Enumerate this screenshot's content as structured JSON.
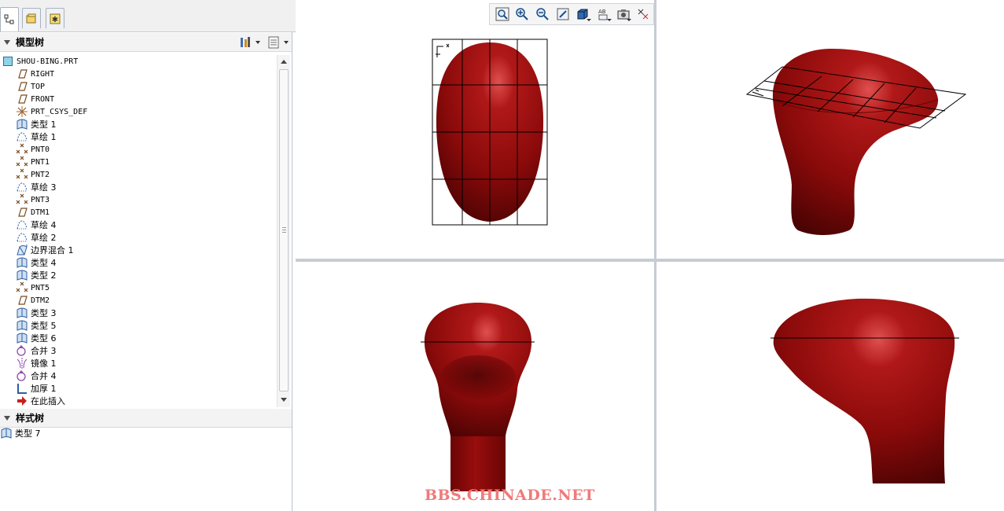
{
  "model_tree": {
    "header": "模型树",
    "root": "SHOU-BING.PRT",
    "items": [
      {
        "label": "RIGHT",
        "icon": "datum-plane-icon",
        "mono": true
      },
      {
        "label": "TOP",
        "icon": "datum-plane-icon",
        "mono": true
      },
      {
        "label": "FRONT",
        "icon": "datum-plane-icon",
        "mono": true
      },
      {
        "label": "PRT_CSYS_DEF",
        "icon": "coordinate-system-icon",
        "mono": true
      },
      {
        "label": "类型 1",
        "icon": "style-surface-icon"
      },
      {
        "label": "草绘 1",
        "icon": "sketch-icon"
      },
      {
        "label": "PNT0",
        "icon": "datum-point-icon",
        "mono": true
      },
      {
        "label": "PNT1",
        "icon": "datum-point-icon",
        "mono": true
      },
      {
        "label": "PNT2",
        "icon": "datum-point-icon",
        "mono": true
      },
      {
        "label": "草绘 3",
        "icon": "sketch-icon"
      },
      {
        "label": "PNT3",
        "icon": "datum-point-icon",
        "mono": true
      },
      {
        "label": "DTM1",
        "icon": "datum-plane-icon",
        "mono": true
      },
      {
        "label": "草绘 4",
        "icon": "sketch-icon"
      },
      {
        "label": "草绘 2",
        "icon": "sketch-icon"
      },
      {
        "label": "边界混合 1",
        "icon": "boundary-blend-icon"
      },
      {
        "label": "类型 4",
        "icon": "style-surface-icon"
      },
      {
        "label": "类型 2",
        "icon": "style-surface-icon"
      },
      {
        "label": "PNT5",
        "icon": "datum-point-icon",
        "mono": true
      },
      {
        "label": "DTM2",
        "icon": "datum-plane-icon",
        "mono": true
      },
      {
        "label": "类型 3",
        "icon": "style-surface-icon"
      },
      {
        "label": "类型 5",
        "icon": "style-surface-icon"
      },
      {
        "label": "类型 6",
        "icon": "style-surface-icon"
      },
      {
        "label": "合并 3",
        "icon": "merge-icon"
      },
      {
        "label": "镜像 1",
        "icon": "mirror-icon"
      },
      {
        "label": "合并 4",
        "icon": "merge-icon"
      },
      {
        "label": "加厚 1",
        "icon": "thicken-icon"
      },
      {
        "label": "在此插入",
        "icon": "insert-here-arrow-icon"
      }
    ]
  },
  "style_tree": {
    "header": "样式树",
    "items": [
      {
        "label": "类型 7",
        "icon": "style-surface-icon"
      }
    ]
  },
  "view_toolbar": {
    "buttons": [
      "refit-icon",
      "zoom-in-icon",
      "zoom-out-icon",
      "repaint-icon",
      "display-style-icon",
      "annotation-display-icon",
      "saved-orientations-icon",
      "datum-display-icon"
    ]
  },
  "watermark": "BBS.CHINADE.NET",
  "colors": {
    "model_red": "#8a0a0a",
    "panel_bg": "#f0f0f0",
    "divider": "#c6ccd4",
    "watermark": "#f07a7a"
  }
}
